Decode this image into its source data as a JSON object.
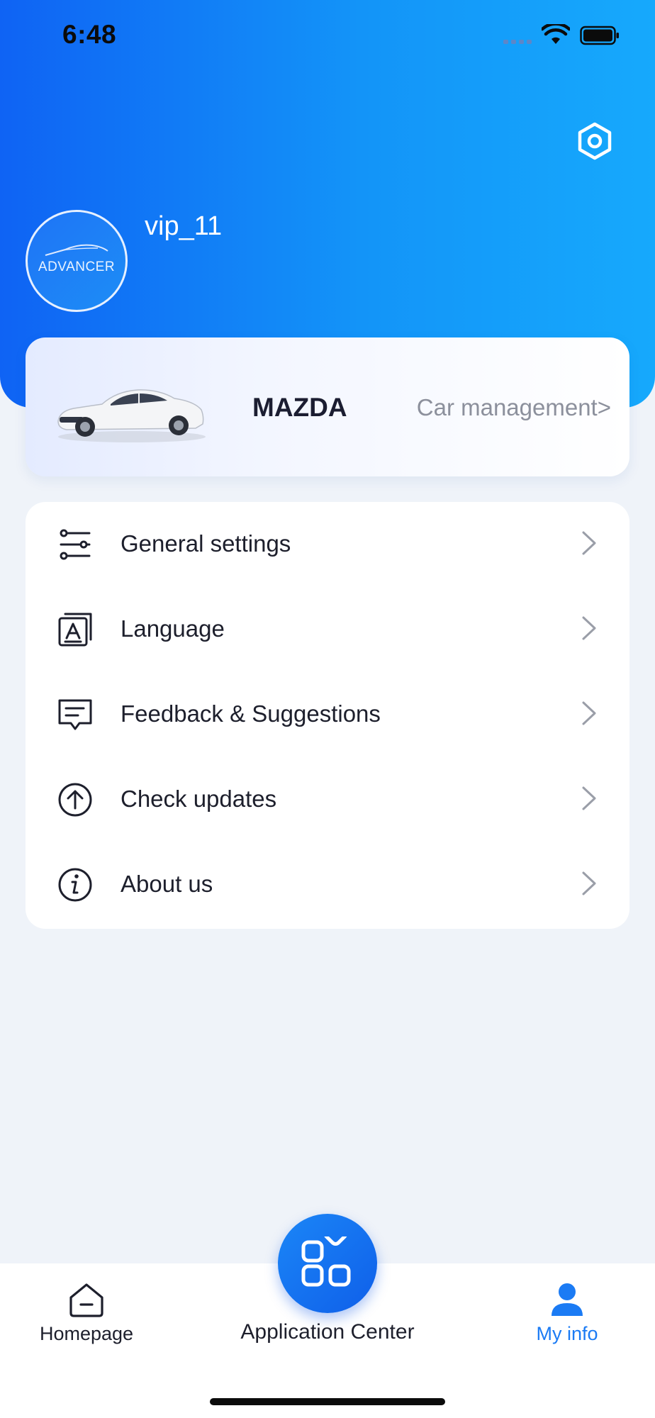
{
  "status_bar": {
    "time": "6:48"
  },
  "profile": {
    "username": "vip_11",
    "avatar_text": "ADVANCER",
    "settings_icon": "hexagon-settings-icon"
  },
  "car": {
    "brand": "MAZDA",
    "manage_label": "Car management>"
  },
  "menu": {
    "items": [
      {
        "label": "General settings",
        "icon": "sliders-icon"
      },
      {
        "label": "Language",
        "icon": "language-icon"
      },
      {
        "label": "Feedback & Suggestions",
        "icon": "feedback-icon"
      },
      {
        "label": "Check updates",
        "icon": "upload-arrow-icon"
      },
      {
        "label": "About us",
        "icon": "info-icon"
      }
    ]
  },
  "tabbar": {
    "home_label": "Homepage",
    "center_label": "Application Center",
    "my_label": "My info",
    "active_tab": "My info",
    "active_color": "#1b7bf4"
  },
  "colors": {
    "accent": "#1b7bf4",
    "gradient_start": "#0f63f4",
    "gradient_end": "#16a9fc",
    "background": "#eff3f9"
  }
}
